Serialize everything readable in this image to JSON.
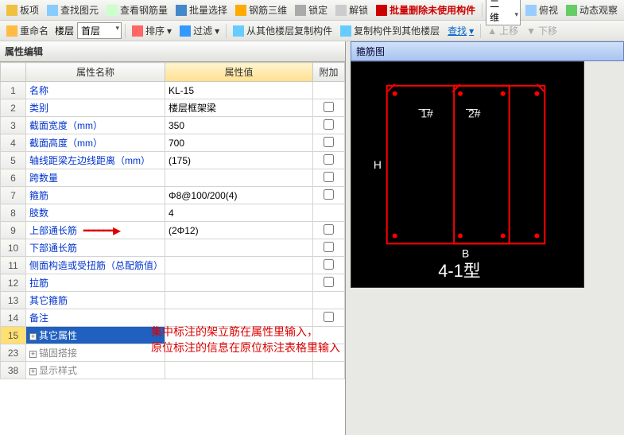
{
  "toolbar1": {
    "items": [
      "板项",
      "查找图元",
      "查看钢筋量",
      "批量选择",
      "钢筋三维",
      "锁定",
      "解锁"
    ],
    "red_action": "批量删除未使用构件",
    "tail": [
      "二维",
      "俯视",
      "动态观察"
    ]
  },
  "toolbar2": {
    "rename": "重命名",
    "floor_label": "楼层",
    "floor_value": "首层",
    "sort": "排序",
    "filter": "过滤",
    "copy_from": "从其他楼层复制构件",
    "copy_to": "复制构件到其他楼层",
    "find": "查找",
    "up": "上移",
    "down": "下移"
  },
  "panel": {
    "title": "属性编辑"
  },
  "headers": {
    "name": "属性名称",
    "value": "属性值",
    "extra": "附加"
  },
  "rows": [
    {
      "n": "1",
      "name": "名称",
      "val": "KL-15",
      "chk": false,
      "showchk": false
    },
    {
      "n": "2",
      "name": "类别",
      "val": "楼层框架梁",
      "chk": false,
      "showchk": true
    },
    {
      "n": "3",
      "name": "截面宽度（mm）",
      "val": "350",
      "chk": false,
      "showchk": true
    },
    {
      "n": "4",
      "name": "截面高度（mm）",
      "val": "700",
      "chk": false,
      "showchk": true
    },
    {
      "n": "5",
      "name": "轴线距梁左边线距离（mm）",
      "val": "(175)",
      "chk": false,
      "showchk": true
    },
    {
      "n": "6",
      "name": "跨数量",
      "val": "",
      "chk": false,
      "showchk": true
    },
    {
      "n": "7",
      "name": "箍筋",
      "val": "Φ8@100/200(4)",
      "chk": false,
      "showchk": true
    },
    {
      "n": "8",
      "name": "肢数",
      "val": "4",
      "chk": false,
      "showchk": false
    },
    {
      "n": "9",
      "name": "上部通长筋",
      "val": "(2Φ12)",
      "chk": false,
      "showchk": true,
      "arrow": true
    },
    {
      "n": "10",
      "name": "下部通长筋",
      "val": "",
      "chk": false,
      "showchk": true
    },
    {
      "n": "11",
      "name": "侧面构造或受扭筋（总配筋值）",
      "val": "",
      "chk": false,
      "showchk": true
    },
    {
      "n": "12",
      "name": "拉筋",
      "val": "",
      "chk": false,
      "showchk": true
    },
    {
      "n": "13",
      "name": "其它箍筋",
      "val": "",
      "chk": false,
      "showchk": false
    },
    {
      "n": "14",
      "name": "备注",
      "val": "",
      "chk": false,
      "showchk": true
    },
    {
      "n": "15",
      "name": "其它属性",
      "val": "",
      "chk": false,
      "showchk": false,
      "selected": true,
      "expand": "+"
    },
    {
      "n": "23",
      "name": "锚固搭接",
      "val": "",
      "chk": false,
      "showchk": false,
      "gray": true,
      "expand": "+"
    },
    {
      "n": "38",
      "name": "显示样式",
      "val": "",
      "chk": false,
      "showchk": false,
      "gray": true,
      "expand": "+"
    }
  ],
  "diagram": {
    "title": "箍筋图",
    "label1": "1#",
    "label2": "2#",
    "axisB": "B",
    "axisH": "H",
    "type": "4-1型"
  },
  "note": {
    "line1": "集中标注的架立筋在属性里输入，",
    "line2": "原位标注的信息在原位标注表格里输入"
  }
}
